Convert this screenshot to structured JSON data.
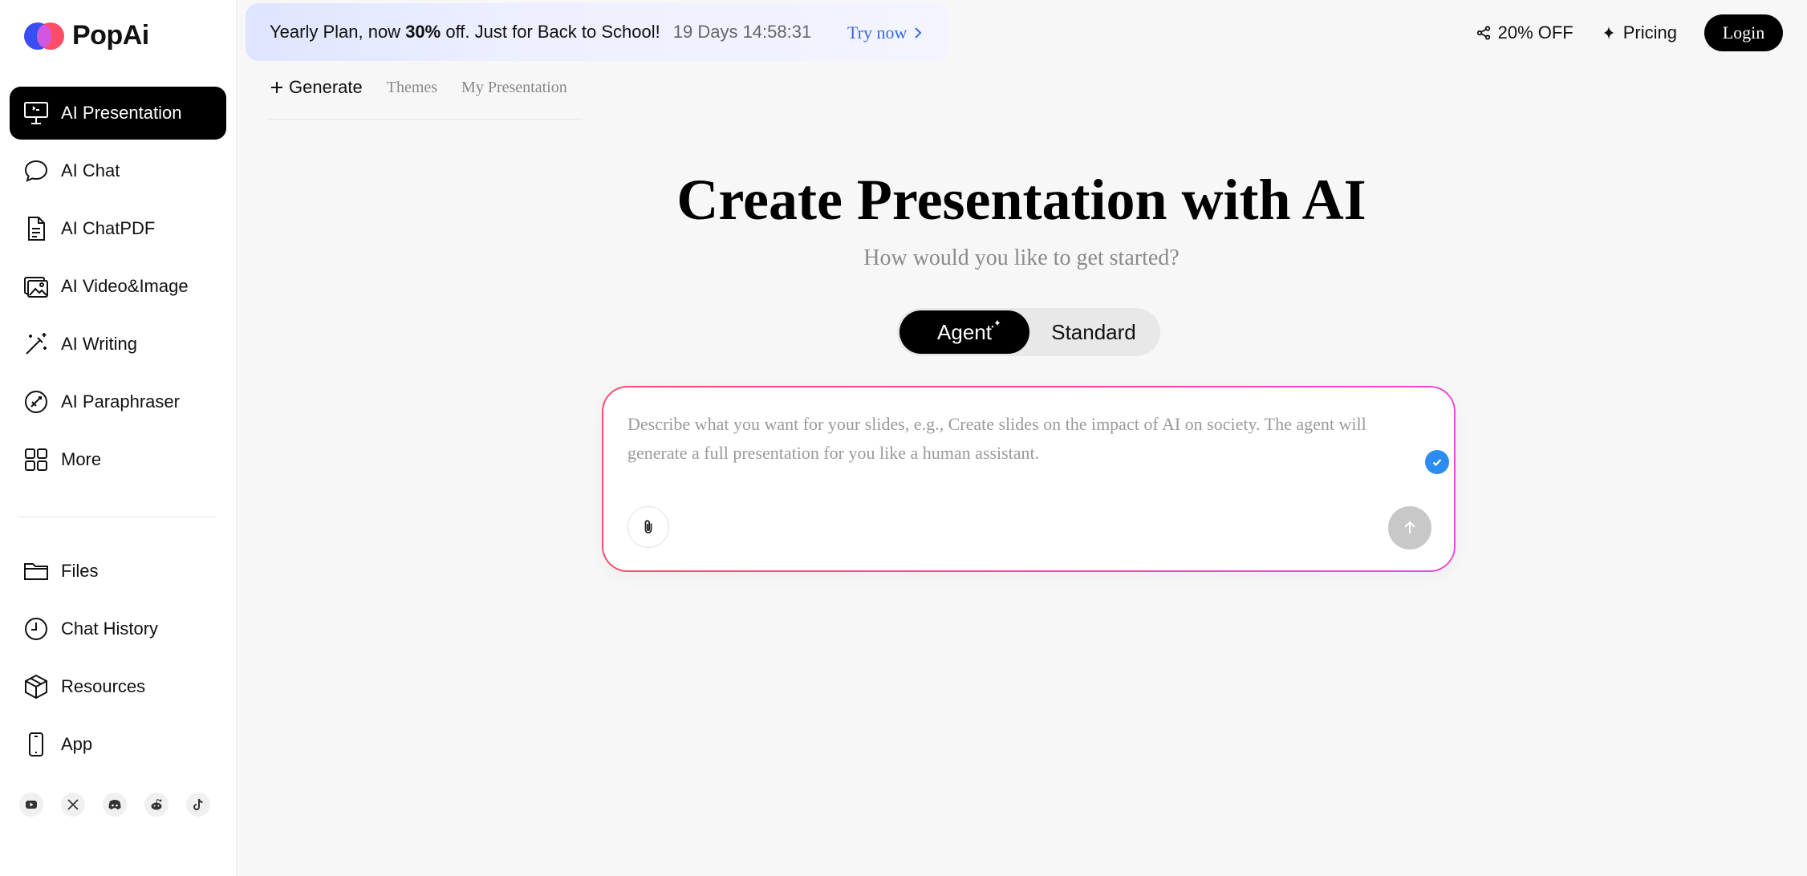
{
  "brand": {
    "name": "PopAi"
  },
  "sidebar": {
    "items": [
      {
        "label": "AI Presentation",
        "icon": "presentation-icon",
        "active": true
      },
      {
        "label": "AI Chat",
        "icon": "chat-bubble-icon"
      },
      {
        "label": "AI ChatPDF",
        "icon": "document-icon"
      },
      {
        "label": "AI Video&Image",
        "icon": "image-icon"
      },
      {
        "label": "AI Writing",
        "icon": "magic-wand-icon"
      },
      {
        "label": "AI Paraphraser",
        "icon": "paraphrase-icon"
      },
      {
        "label": "More",
        "icon": "grid-icon"
      }
    ],
    "secondary": [
      {
        "label": "Files",
        "icon": "folder-icon"
      },
      {
        "label": "Chat History",
        "icon": "clock-icon"
      },
      {
        "label": "Resources",
        "icon": "box-icon"
      },
      {
        "label": "App",
        "icon": "phone-icon"
      }
    ],
    "social": [
      "youtube-icon",
      "x-icon",
      "discord-icon",
      "reddit-icon",
      "tiktok-icon"
    ]
  },
  "banner": {
    "msg_prefix": "Yearly Plan, now ",
    "msg_bold": "30%",
    "msg_suffix": " off. Just for Back to School!",
    "timer": "19 Days 14:58:31",
    "cta": "Try now"
  },
  "header": {
    "discount": "20% OFF",
    "pricing": "Pricing",
    "login": "Login"
  },
  "tabs": {
    "generate": "Generate",
    "themes": "Themes",
    "my_presentation": "My Presentation"
  },
  "hero": {
    "title": "Create Presentation with AI",
    "subtitle": "How would you like to get started?"
  },
  "mode_toggle": {
    "agent": "Agent",
    "standard": "Standard",
    "selected": "Agent"
  },
  "prompt": {
    "value": "",
    "placeholder": "Describe what you want for your slides, e.g., Create slides on the impact of AI on society. The agent will generate a full presentation for you like a human assistant."
  },
  "colors": {
    "accent_blue": "#2d8cf0",
    "link_blue": "#3a6bdc",
    "prompt_border_start": "#ff4d6d",
    "prompt_border_end": "#e84dd8"
  }
}
